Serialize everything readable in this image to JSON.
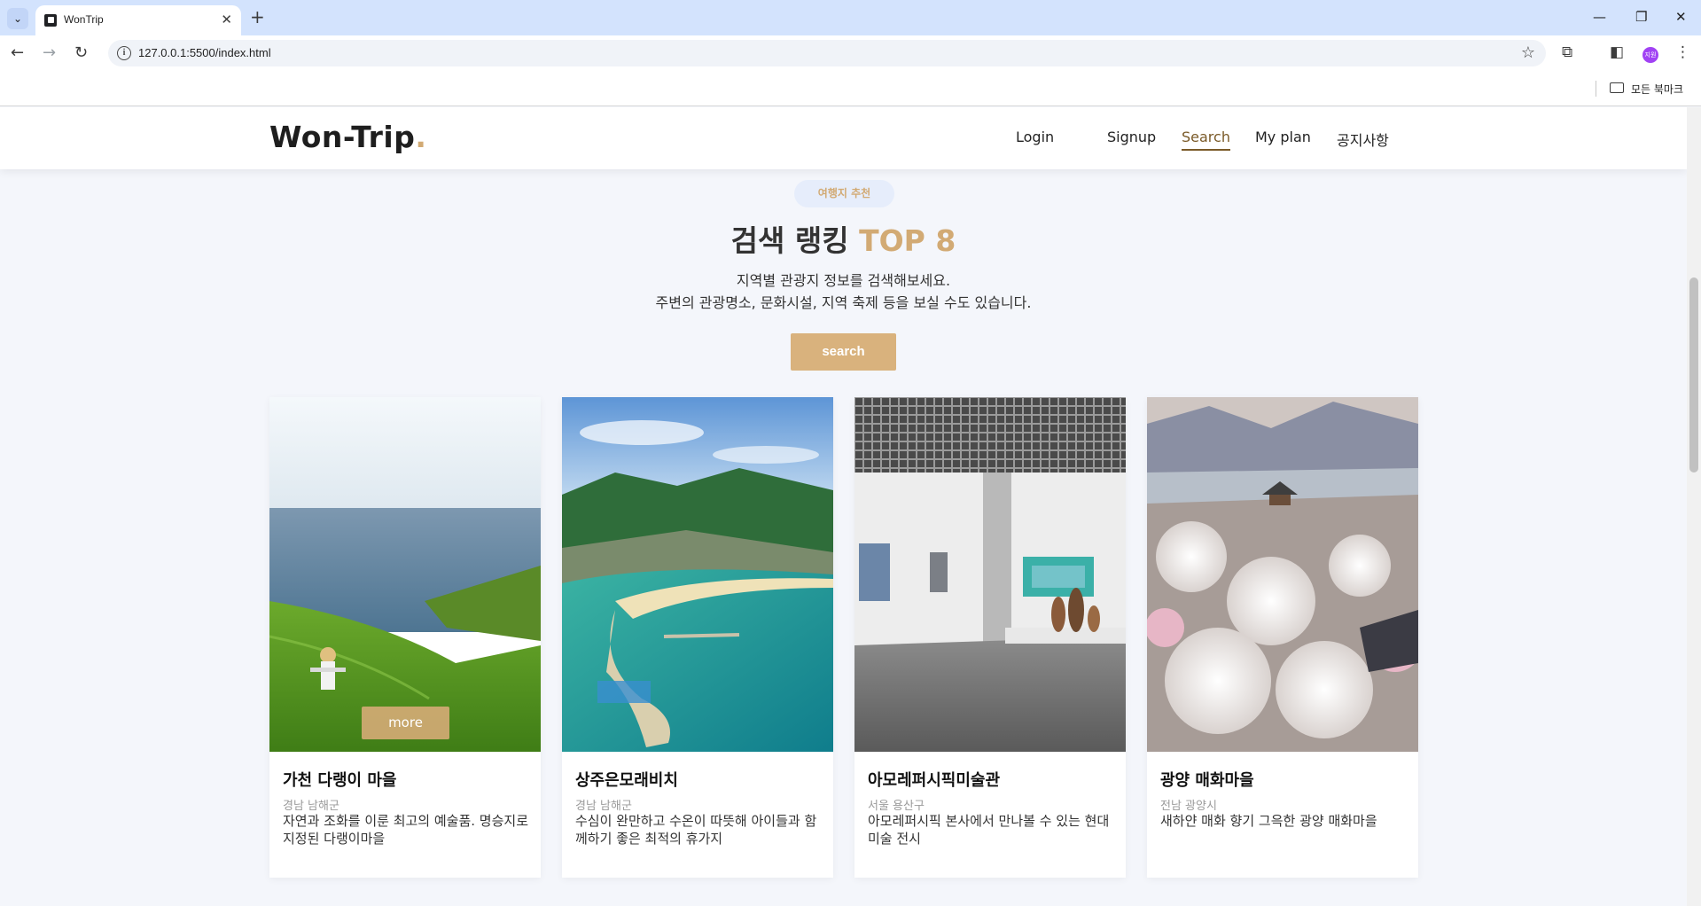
{
  "browser": {
    "tab_title": "WonTrip",
    "url": "127.0.0.1:5500/index.html",
    "bookmarks_label": "모든 북마크",
    "profile_label": "지원"
  },
  "header": {
    "logo_text": "Won-Trip",
    "logo_dot": ".",
    "nav": [
      {
        "label": "Login"
      },
      {
        "label": "Signup"
      },
      {
        "label": "Search",
        "active": true
      },
      {
        "label": "My plan"
      },
      {
        "label": "공지사항"
      }
    ]
  },
  "section": {
    "badge": "여행지 추천",
    "title": "검색 랭킹",
    "title_accent": "TOP 8",
    "desc_line1": "지역별 관광지 정보를 검색해보세요.",
    "desc_line2": "주변의 관광명소, 문화시설, 지역 축제 등을 보실 수도 있습니다.",
    "search_label": "search"
  },
  "cards": [
    {
      "title": "가천 다랭이 마을",
      "region": "경남 남해군",
      "desc": "자연과 조화를 이룬 최고의 예술품. 명승지로 지정된 다랭이마을",
      "more_label": "more"
    },
    {
      "title": "상주은모래비치",
      "region": "경남 남해군",
      "desc": "수심이 완만하고 수온이 따뜻해 아이들과 함께하기 좋은 최적의 휴가지"
    },
    {
      "title": "아모레퍼시픽미술관",
      "region": "서울 용산구",
      "desc": "아모레퍼시픽 본사에서 만나볼 수 있는 현대 미술 전시"
    },
    {
      "title": "광양 매화마을",
      "region": "전남 광양시",
      "desc": "새하얀 매화 향기 그윽한 광양 매화마을"
    }
  ],
  "colors": {
    "accent": "#d2aa74",
    "button": "#d9b27d",
    "badge_bg": "#e6edfb",
    "page_bg": "#f4f6fb"
  }
}
